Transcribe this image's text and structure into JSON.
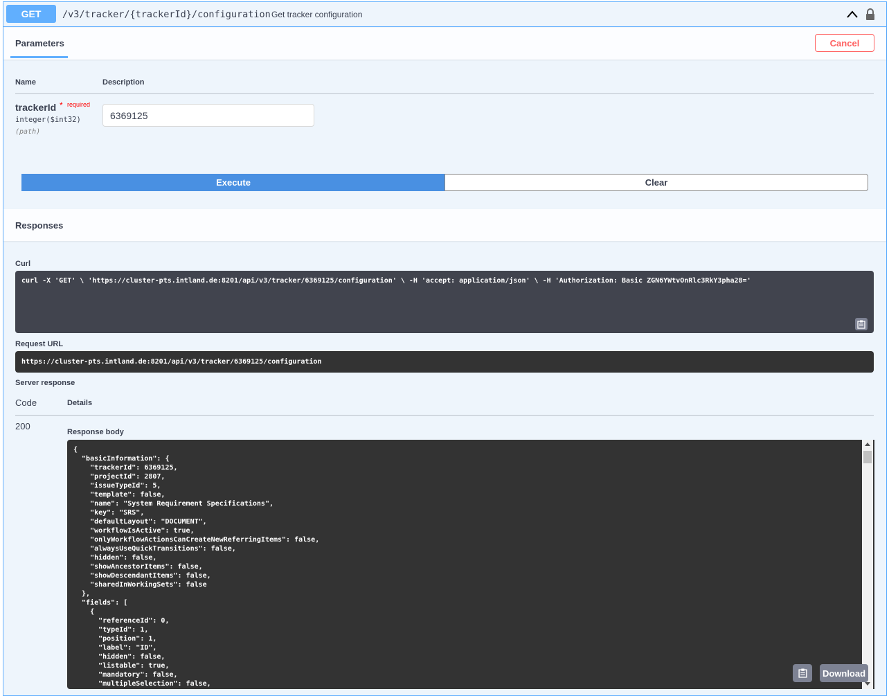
{
  "summary": {
    "method": "GET",
    "path": "/v3/tracker/{trackerId}/configuration",
    "description": "Get tracker configuration"
  },
  "parameters": {
    "tab_label": "Parameters",
    "cancel_label": "Cancel",
    "col_name": "Name",
    "col_description": "Description",
    "param": {
      "name": "trackerId",
      "star": "*",
      "required": "required",
      "type": "integer($int32)",
      "in": "(path)",
      "value": "6369125"
    },
    "execute_label": "Execute",
    "clear_label": "Clear"
  },
  "responses": {
    "title": "Responses",
    "curl_label": "Curl",
    "curl": "curl -X 'GET' \\ 'https://cluster-pts.intland.de:8201/api/v3/tracker/6369125/configuration' \\ -H 'accept: application/json' \\ -H 'Authorization: Basic ZGN6YWtvOnRlc3RkY3pha28='",
    "request_url_label": "Request URL",
    "request_url": "https://cluster-pts.intland.de:8201/api/v3/tracker/6369125/configuration",
    "server_response_label": "Server response",
    "code_label": "Code",
    "details_label": "Details",
    "status_code": "200",
    "body_label": "Response body",
    "body": "{\n  \"basicInformation\": {\n    \"trackerId\": 6369125,\n    \"projectId\": 2807,\n    \"issueTypeId\": 5,\n    \"template\": false,\n    \"name\": \"System Requirement Specifications\",\n    \"key\": \"SRS\",\n    \"defaultLayout\": \"DOCUMENT\",\n    \"workflowIsActive\": true,\n    \"onlyWorkflowActionsCanCreateNewReferringItems\": false,\n    \"alwaysUseQuickTransitions\": false,\n    \"hidden\": false,\n    \"showAncestorItems\": false,\n    \"showDescendantItems\": false,\n    \"sharedInWorkingSets\": false\n  },\n  \"fields\": [\n    {\n      \"referenceId\": 0,\n      \"typeId\": 1,\n      \"position\": 1,\n      \"label\": \"ID\",\n      \"hidden\": false,\n      \"listable\": true,\n      \"mandatory\": false,\n      \"multipleSelection\": false,",
    "download_label": "Download"
  },
  "icons": {
    "collapse": "chevron-up-icon",
    "lock": "lock-icon",
    "copy": "clipboard-icon"
  },
  "colors": {
    "get_accent": "#61affe",
    "execute": "#4990e2",
    "cancel": "#ff6060",
    "code_bg": "#333333"
  }
}
